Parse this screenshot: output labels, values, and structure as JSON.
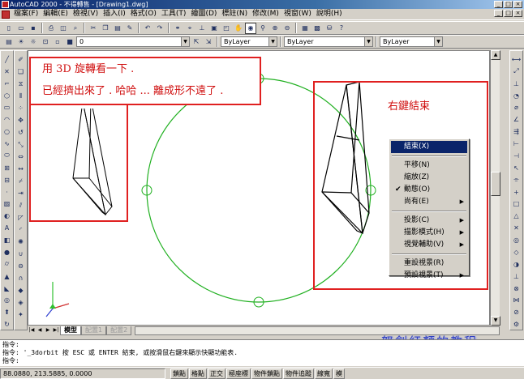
{
  "window": {
    "title": "AutoCAD 2000 - 不得轉售 - [Drawing1.dwg]",
    "buttons": [
      "_",
      "□",
      "×"
    ]
  },
  "menubar": {
    "items": [
      "檔案(F)",
      "編輯(E)",
      "檢視(V)",
      "插入(I)",
      "格式(O)",
      "工具(T)",
      "繪圖(D)",
      "標註(N)",
      "修改(M)",
      "視窗(W)",
      "說明(H)"
    ]
  },
  "properties_toolbar": {
    "layer_value": "0",
    "color_value": "ByLayer",
    "linetype_value": "ByLayer"
  },
  "annotations": {
    "left_line1": "用 3D 旋轉看一下 .",
    "left_line2": "已經擠出來了 . 哈哈 ... 離成形不遠了 .",
    "right_label": "右鍵結束"
  },
  "context_menu": {
    "items": [
      {
        "label": "結束(X)",
        "selected": true
      },
      {
        "sep": true
      },
      {
        "label": "平移(N)"
      },
      {
        "label": "縮放(Z)"
      },
      {
        "label": "動態(O)",
        "checked": true
      },
      {
        "label": "尚有(E)",
        "submenu": true
      },
      {
        "sep": true
      },
      {
        "label": "投影(C)",
        "submenu": true
      },
      {
        "label": "描影模式(H)",
        "submenu": true
      },
      {
        "label": "視覺輔助(V)",
        "submenu": true
      },
      {
        "sep": true
      },
      {
        "label": "重設視景(R)"
      },
      {
        "label": "預設視景(T)",
        "submenu": true
      }
    ]
  },
  "tabs": {
    "model": "模型",
    "layout1": "配置1",
    "layout2": "配置2"
  },
  "command_line": {
    "line1": "指令:",
    "line2": "指令: '_3dorbit 按 ESC 或 ENTER 結束, 或按滑鼠右鍵來顯示快顯功能表.",
    "line3": "指令:"
  },
  "statusbar": {
    "coords": "88.0880, 213.5885, 0.0000",
    "toggles": [
      "鎖點",
      "格點",
      "正交",
      "極座標",
      "物件鎖點",
      "物件追蹤",
      "線寬",
      "模"
    ]
  },
  "watermark": "怒劍紅顏的教程",
  "colors": {
    "annotation_red": "#e02020",
    "orbit_green": "#20b020",
    "menu_highlight": "#0a246a"
  }
}
